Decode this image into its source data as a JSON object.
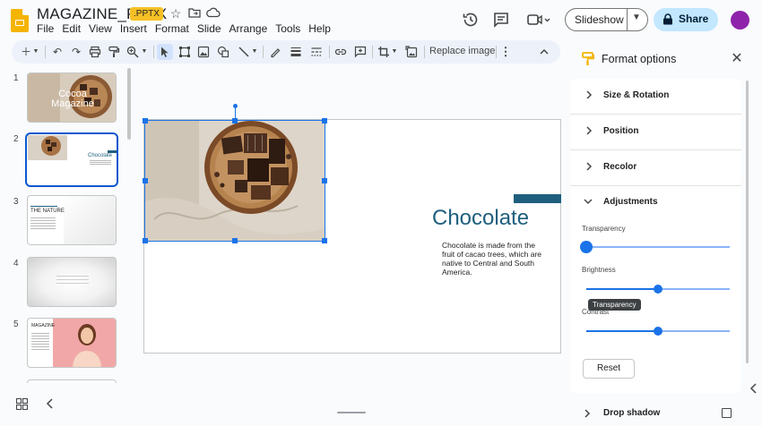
{
  "header": {
    "doc_title": "MAGAZINE_PPTX",
    "ext_badge": ".PPTX",
    "menu": [
      "File",
      "Edit",
      "View",
      "Insert",
      "Format",
      "Slide",
      "Arrange",
      "Tools",
      "Help"
    ],
    "slideshow_label": "Slideshow",
    "share_label": "Share"
  },
  "toolbar": {
    "replace_image_label": "Replace image"
  },
  "filmstrip": {
    "slides": [
      {
        "num": "1",
        "thumb_text": "Cocoa Magazine"
      },
      {
        "num": "2",
        "thumb_text": "Chocolate"
      },
      {
        "num": "3",
        "thumb_text": "THE NATURE"
      },
      {
        "num": "4",
        "thumb_text": ""
      },
      {
        "num": "5",
        "thumb_text": "MAGAZINE"
      }
    ],
    "active_slide": 2
  },
  "slide": {
    "title": "Chocolate",
    "body": "Chocolate is made from the fruit of cacao trees, which are native to Central and South America."
  },
  "panel": {
    "title": "Format options",
    "sections": [
      "Size & Rotation",
      "Position",
      "Recolor",
      "Adjustments"
    ],
    "adjustments": {
      "transparency_label": "Transparency",
      "transparency_value": 0,
      "brightness_label": "Brightness",
      "brightness_value": 0.5,
      "contrast_label": "Contrast",
      "contrast_value": 0.5,
      "tooltip": "Transparency",
      "reset_label": "Reset"
    },
    "drop_shadow_label": "Drop shadow",
    "drop_shadow_checked": false
  },
  "colors": {
    "accent": "#1a73e8",
    "title_teal": "#1f5f7e",
    "share_bg": "#c2e7ff",
    "avatar": "#8e24aa"
  }
}
